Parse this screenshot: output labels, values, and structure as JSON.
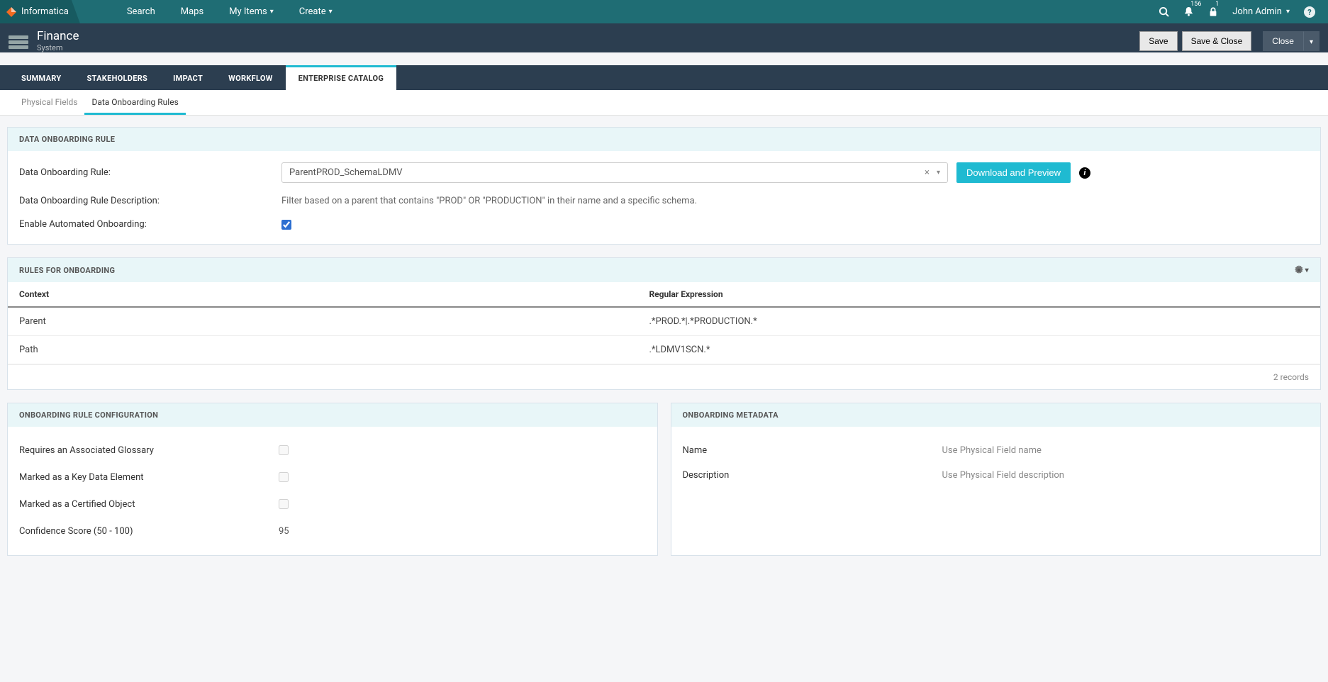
{
  "brand": "Informatica",
  "nav": {
    "search": "Search",
    "maps": "Maps",
    "myitems": "My Items",
    "create": "Create"
  },
  "topright": {
    "bell_count": "156",
    "lock_count": "1",
    "user": "John Admin"
  },
  "page": {
    "title": "Finance",
    "subtitle": "System"
  },
  "actions": {
    "save": "Save",
    "save_close": "Save & Close",
    "close": "Close"
  },
  "tabs": {
    "summary": "SUMMARY",
    "stakeholders": "STAKEHOLDERS",
    "impact": "IMPACT",
    "workflow": "WORKFLOW",
    "catalog": "ENTERPRISE CATALOG"
  },
  "subtabs": {
    "physical": "Physical Fields",
    "onboarding": "Data Onboarding Rules"
  },
  "rule_panel": {
    "header": "DATA ONBOARDING RULE",
    "rule_label": "Data Onboarding Rule:",
    "rule_value": "ParentPROD_SchemaLDMV",
    "desc_label": "Data Onboarding Rule Description:",
    "desc_value": "Filter based on a parent that contains \"PROD\" OR \"PRODUCTION\" in their name and a specific schema.",
    "enable_label": "Enable Automated Onboarding:",
    "download_btn": "Download and Preview"
  },
  "rules_table": {
    "header": "RULES FOR ONBOARDING",
    "col_context": "Context",
    "col_regex": "Regular Expression",
    "rows": [
      {
        "context": "Parent",
        "regex": ".*PROD.*|.*PRODUCTION.*"
      },
      {
        "context": "Path",
        "regex": ".*LDMV1SCN.*"
      }
    ],
    "footer": "2 records"
  },
  "config_panel": {
    "header": "ONBOARDING RULE CONFIGURATION",
    "rows": {
      "glossary": "Requires an Associated Glossary",
      "keydata": "Marked as a Key Data Element",
      "certified": "Marked as a Certified Object",
      "confidence_label": "Confidence Score (50 - 100)",
      "confidence_value": "95"
    }
  },
  "metadata_panel": {
    "header": "ONBOARDING METADATA",
    "name_label": "Name",
    "name_value": "Use Physical Field name",
    "desc_label": "Description",
    "desc_value": "Use Physical Field description"
  }
}
